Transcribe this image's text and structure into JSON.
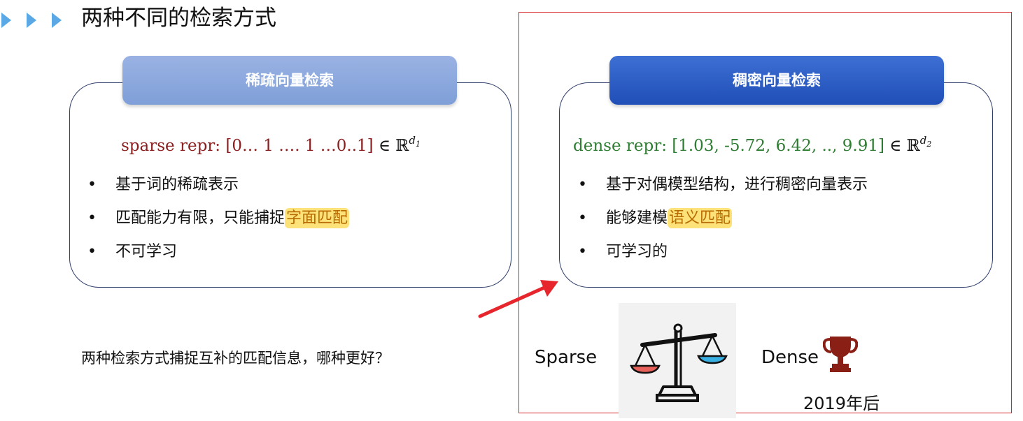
{
  "page": {
    "title": "两种不同的检索方式"
  },
  "icons": {
    "chevrons": "triple-chevron-right-icon",
    "balance": "balance-scale-icon",
    "trophy": "trophy-icon",
    "arrow": "red-arrow-icon"
  },
  "colors": {
    "sparse_tab": "#8fa9df",
    "dense_tab": "#2a5cc4",
    "card_border": "#2f3e6b",
    "sparse_repr": "#8b1e1e",
    "dense_repr": "#2e7d32",
    "highlight": "#fde27a",
    "red_frame": "#d6232a",
    "chevron": "#5aa9e6"
  },
  "sparse": {
    "tab_label": "稀疏向量检索",
    "repr_text": "sparse repr:  [0… 1 …. 1 …0..1]",
    "repr_tail": "∈ ℝ",
    "repr_exp": "d",
    "repr_exp_sub": "1",
    "bullets": [
      {
        "text": "基于词的稀疏表示"
      },
      {
        "text": "匹配能力有限，只能捕捉",
        "highlight": "字面匹配"
      },
      {
        "text": "不可学习"
      }
    ]
  },
  "dense": {
    "tab_label": "稠密向量检索",
    "repr_text": "dense repr:  [1.03, -5.72, 6.42, .., 9.91]",
    "repr_tail": "∈ ℝ",
    "repr_exp": "d",
    "repr_exp_sub": "2",
    "bullets": [
      {
        "text": "基于对偶模型结构，进行稠密向量表示"
      },
      {
        "text": "能够建模",
        "highlight": "语义匹配"
      },
      {
        "text": "可学习的"
      }
    ]
  },
  "bullet_char": "•",
  "question": "两种检索方式捕捉互补的匹配信息，哪种更好？",
  "comparison": {
    "left_label": "Sparse",
    "right_label": "Dense",
    "year_note": "2019年后"
  }
}
